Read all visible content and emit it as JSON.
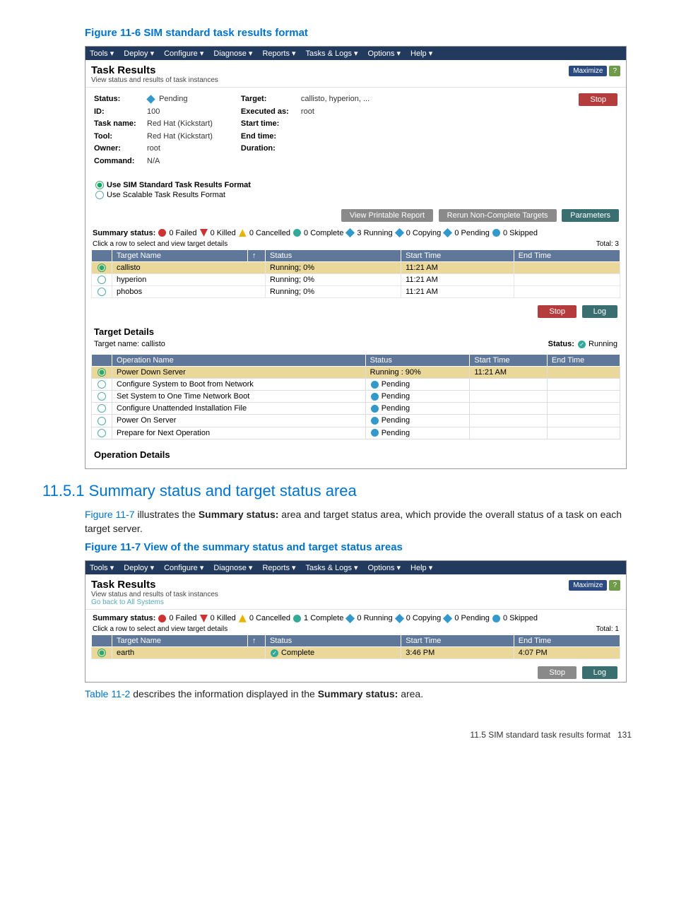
{
  "fig1_caption": "Figure 11-6 SIM standard task results format",
  "menubar": [
    "Tools ▾",
    "Deploy ▾",
    "Configure ▾",
    "Diagnose ▾",
    "Reports ▾",
    "Tasks & Logs ▾",
    "Options ▾",
    "Help ▾"
  ],
  "task_results_title": "Task Results",
  "task_results_sub": "View status and results of task instances",
  "maximize": "Maximize",
  "help_q": "?",
  "left_info": [
    {
      "label": "Status:",
      "val": "Pending",
      "pending": true
    },
    {
      "label": "ID:",
      "val": "100"
    },
    {
      "label": "Task name:",
      "val": "Red Hat (Kickstart)"
    },
    {
      "label": "Tool:",
      "val": "Red Hat (Kickstart)"
    },
    {
      "label": "Owner:",
      "val": "root"
    },
    {
      "label": "Command:",
      "val": "N/A"
    }
  ],
  "mid_info": [
    {
      "label": "Target:",
      "val": "callisto, hyperion, ..."
    },
    {
      "label": "Executed as:",
      "val": "root"
    },
    {
      "label": "Start time:",
      "val": ""
    },
    {
      "label": "End time:",
      "val": ""
    },
    {
      "label": "Duration:",
      "val": ""
    }
  ],
  "stop": "Stop",
  "radio1": "Use SIM Standard Task Results Format",
  "radio2": "Use Scalable Task Results Format",
  "btns": {
    "view": "View Printable Report",
    "rerun": "Rerun Non-Complete Targets",
    "params": "Parameters"
  },
  "summary_label": "Summary status:",
  "summary_parts": [
    "0 Failed",
    "0 Killed",
    "0 Cancelled",
    "0 Complete",
    "3 Running",
    "0 Copying",
    "0 Pending",
    "0 Skipped"
  ],
  "click_row": "Click a row to select and view target details",
  "total3": "Total: 3",
  "cols": [
    "Target Name",
    "Status",
    "Start Time",
    "End Time"
  ],
  "sort_arrow": "↑",
  "rows": [
    {
      "sel": true,
      "name": "callisto",
      "status": "Running; 0%",
      "start": "11:21 AM",
      "end": ""
    },
    {
      "sel": false,
      "name": "hyperion",
      "status": "Running; 0%",
      "start": "11:21 AM",
      "end": ""
    },
    {
      "sel": false,
      "name": "phobos",
      "status": "Running; 0%",
      "start": "11:21 AM",
      "end": ""
    }
  ],
  "stop2": "Stop",
  "log": "Log",
  "target_details": "Target Details",
  "target_name_line": "Target name: callisto",
  "status_running": "Status:",
  "running_word": "Running",
  "op_cols": [
    "Operation Name",
    "Status",
    "Start Time",
    "End Time"
  ],
  "ops": [
    {
      "sel": true,
      "name": "Power Down Server",
      "status": "Running : 90%",
      "start": "11:21 AM",
      "end": ""
    },
    {
      "sel": false,
      "name": "Configure System to Boot from Network",
      "status": "Pending",
      "start": "",
      "end": ""
    },
    {
      "sel": false,
      "name": "Set System to One Time Network Boot",
      "status": "Pending",
      "start": "",
      "end": ""
    },
    {
      "sel": false,
      "name": "Configure Unattended Installation File",
      "status": "Pending",
      "start": "",
      "end": ""
    },
    {
      "sel": false,
      "name": "Power On Server",
      "status": "Pending",
      "start": "",
      "end": ""
    },
    {
      "sel": false,
      "name": "Prepare for Next Operation",
      "status": "Pending",
      "start": "",
      "end": ""
    }
  ],
  "op_details": "Operation Details",
  "section_heading_num": "11.5.1",
  "section_heading": "Summary status and target status area",
  "para1_a": "Figure 11-7",
  "para1_b": " illustrates the ",
  "para1_bold": "Summary status:",
  "para1_c": " area and target status area, which provide the overall status of a task on each target server.",
  "fig2_caption": "Figure 11-7 View of the summary status and target status areas",
  "go_back": "Go back to All Systems",
  "summary2_parts": [
    "0 Failed",
    "0 Killed",
    "0 Cancelled",
    "1 Complete",
    "0 Running",
    "0 Copying",
    "0 Pending",
    "0 Skipped"
  ],
  "total1": "Total: 1",
  "row2": {
    "name": "earth",
    "status": "Complete",
    "start": "3:46 PM",
    "end": "4:07 PM"
  },
  "para2_a": "Table 11-2",
  "para2_b": " describes the information displayed in the ",
  "para2_bold": "Summary status:",
  "para2_c": " area.",
  "footer_right": "11.5 SIM standard task results format",
  "footer_page": "131",
  "chart_data": null
}
